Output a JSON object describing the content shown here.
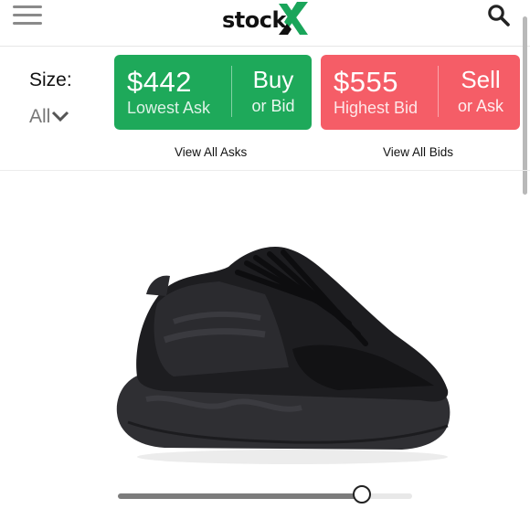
{
  "header": {
    "logo_text": "stock",
    "logo_mark": "X",
    "brand_color": "#1aa55a",
    "menu_icon": "hamburger-menu-icon",
    "search_icon": "search-icon"
  },
  "size": {
    "label": "Size:",
    "selected": "All"
  },
  "ask_card": {
    "price": "$442",
    "caption": "Lowest Ask",
    "action_top": "Buy",
    "action_bottom": "or Bid",
    "color": "#1ea95a",
    "link": "View All Asks"
  },
  "bid_card": {
    "price": "$555",
    "caption": "Highest Bid",
    "action_top": "Sell",
    "action_bottom": "or Ask",
    "color": "#f55d67",
    "link": "View All Bids"
  },
  "viewer": {
    "rotation_progress": 0.83
  }
}
